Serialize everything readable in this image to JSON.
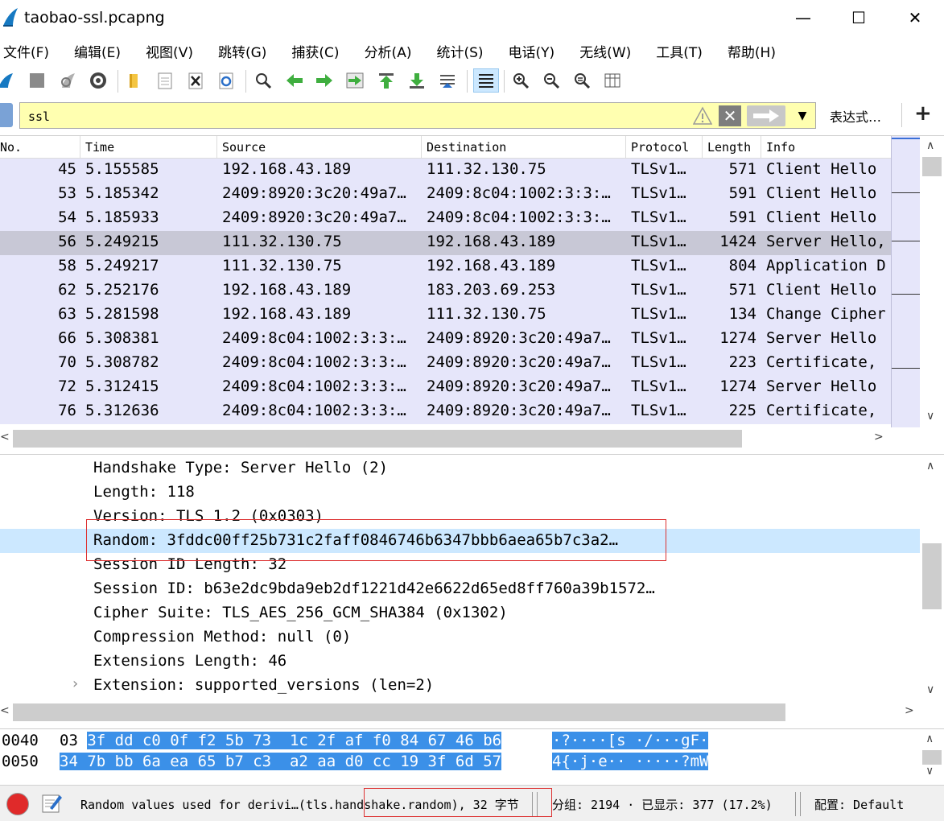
{
  "window": {
    "title": "taobao-ssl.pcapng",
    "minimize_symbol": "—",
    "maximize_symbol": "☐",
    "close_symbol": "✕"
  },
  "menu": [
    {
      "label": "文件(F)"
    },
    {
      "label": "编辑(E)"
    },
    {
      "label": "视图(V)"
    },
    {
      "label": "跳转(G)"
    },
    {
      "label": "捕获(C)"
    },
    {
      "label": "分析(A)"
    },
    {
      "label": "统计(S)"
    },
    {
      "label": "电话(Y)"
    },
    {
      "label": "无线(W)"
    },
    {
      "label": "工具(T)"
    },
    {
      "label": "帮助(H)"
    }
  ],
  "toolbar_icons": [
    "shark-fin-icon",
    "stop-icon",
    "restart-icon",
    "options-gear-icon",
    "open-folder-icon",
    "save-file-icon",
    "close-file-icon",
    "reload-icon",
    "find-icon",
    "go-back-icon",
    "go-forward-icon",
    "go-to-packet-icon",
    "first-packet-icon",
    "last-packet-icon",
    "autoscroll-icon",
    "colorize-icon",
    "zoom-in-icon",
    "zoom-out-icon",
    "normal-size-icon",
    "resize-columns-icon"
  ],
  "filter": {
    "value": "ssl",
    "expression_label": "表达式…",
    "add_label": "+"
  },
  "packet_list": {
    "columns": [
      "No.",
      "Time",
      "Source",
      "Destination",
      "Protocol",
      "Length",
      "Info"
    ],
    "rows": [
      {
        "no": "45",
        "time": "5.155585",
        "source": "192.168.43.189",
        "destination": "111.32.130.75",
        "protocol": "TLSv1…",
        "length": "571",
        "info": "Client Hello"
      },
      {
        "no": "53",
        "time": "5.185342",
        "source": "2409:8920:3c20:49a7…",
        "destination": "2409:8c04:1002:3:3:…",
        "protocol": "TLSv1…",
        "length": "591",
        "info": "Client Hello"
      },
      {
        "no": "54",
        "time": "5.185933",
        "source": "2409:8920:3c20:49a7…",
        "destination": "2409:8c04:1002:3:3:…",
        "protocol": "TLSv1…",
        "length": "591",
        "info": "Client Hello"
      },
      {
        "no": "56",
        "time": "5.249215",
        "source": "111.32.130.75",
        "destination": "192.168.43.189",
        "protocol": "TLSv1…",
        "length": "1424",
        "info": "Server Hello,"
      },
      {
        "no": "58",
        "time": "5.249217",
        "source": "111.32.130.75",
        "destination": "192.168.43.189",
        "protocol": "TLSv1…",
        "length": "804",
        "info": "Application D"
      },
      {
        "no": "62",
        "time": "5.252176",
        "source": "192.168.43.189",
        "destination": "183.203.69.253",
        "protocol": "TLSv1…",
        "length": "571",
        "info": "Client Hello"
      },
      {
        "no": "63",
        "time": "5.281598",
        "source": "192.168.43.189",
        "destination": "111.32.130.75",
        "protocol": "TLSv1…",
        "length": "134",
        "info": "Change Cipher"
      },
      {
        "no": "66",
        "time": "5.308381",
        "source": "2409:8c04:1002:3:3:…",
        "destination": "2409:8920:3c20:49a7…",
        "protocol": "TLSv1…",
        "length": "1274",
        "info": "Server Hello"
      },
      {
        "no": "70",
        "time": "5.308782",
        "source": "2409:8c04:1002:3:3:…",
        "destination": "2409:8920:3c20:49a7…",
        "protocol": "TLSv1…",
        "length": "223",
        "info": "Certificate,"
      },
      {
        "no": "72",
        "time": "5.312415",
        "source": "2409:8c04:1002:3:3:…",
        "destination": "2409:8920:3c20:49a7…",
        "protocol": "TLSv1…",
        "length": "1274",
        "info": "Server Hello"
      },
      {
        "no": "76",
        "time": "5.312636",
        "source": "2409:8c04:1002:3:3:…",
        "destination": "2409:8920:3c20:49a7…",
        "protocol": "TLSv1…",
        "length": "225",
        "info": "Certificate,"
      }
    ],
    "selected_row_no": "56",
    "row_color": "#e6e6fa",
    "selected_row_color": "#c8c8d6"
  },
  "details": {
    "lines": [
      {
        "text": "Handshake Type: Server Hello (2)"
      },
      {
        "text": "Length: 118"
      },
      {
        "text": "Version: TLS 1.2 (0x0303)"
      },
      {
        "text": "Random: 3fddc00ff25b731c2faff0846746b6347bbb6aea65b7c3a2…"
      },
      {
        "text": "Session ID Length: 32"
      },
      {
        "text": "Session ID: b63e2dc9bda9eb2df1221d42e6622d65ed8ff760a39b1572…"
      },
      {
        "text": "Cipher Suite: TLS_AES_256_GCM_SHA384 (0x1302)"
      },
      {
        "text": "Compression Method: null (0)"
      },
      {
        "text": "Extensions Length: 46"
      },
      {
        "text": "Extension: supported_versions (len=2)",
        "expander": "›"
      }
    ],
    "selected_line": "Random",
    "selected_color": "#cce8ff"
  },
  "bytes": {
    "rows": [
      {
        "offset": "0040",
        "hex_plain": "03 ",
        "hex_hl": "3f dd c0 0f f2 5b 73  1c 2f af f0 84 67 46 b6",
        "ascii_plain": "",
        "ascii_hl": "·?····[s ·/···gF·"
      },
      {
        "offset": "0050",
        "hex_plain": "",
        "hex_hl": "34 7b bb 6a ea 65 b7 c3  a2 aa d0 cc 19 3f 6d 57",
        "ascii_plain": "",
        "ascii_hl": "4{·j·e·· ·····?mW"
      }
    ],
    "highlight_color": "#3b90e8"
  },
  "status": {
    "field_info": "Random values used for derivi…(tls.handshake.random), 32 字节",
    "packets": "分组: 2194 · 已显示: 377 (17.2%)",
    "profile": "配置: Default"
  }
}
